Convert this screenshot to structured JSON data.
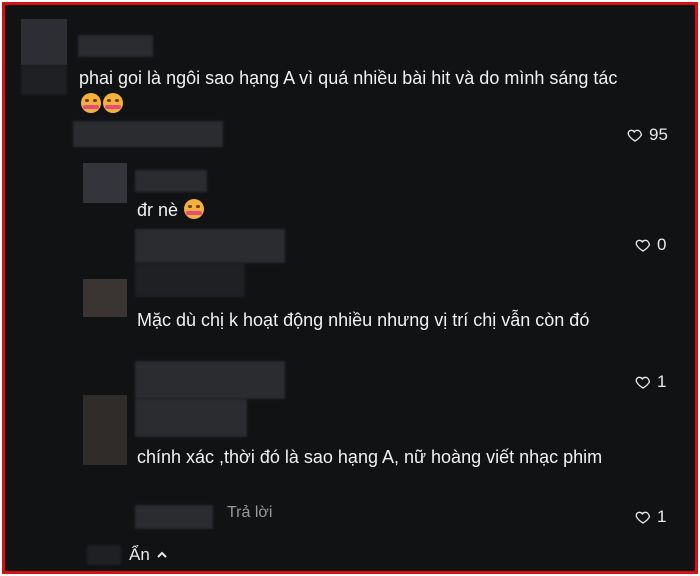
{
  "comments": [
    {
      "text": "phai goi là ngôi sao hạng A vì quá nhiều bài hit và do mình sáng tác",
      "emojis": [
        "smiling-face-with-hearts",
        "smiling-face-with-hearts"
      ],
      "likes": "95"
    }
  ],
  "replies": [
    {
      "text": "đr nè",
      "emojis": [
        "smiling-face-with-hearts"
      ],
      "likes": "0"
    },
    {
      "text": "Mặc dù chị k hoạt động nhiều nhưng vị trí chị vẫn còn đó",
      "likes": "1"
    },
    {
      "text": "chính xác ,thời đó là sao hạng A, nữ hoàng viết nhạc phim",
      "reply_label": "Trả lời",
      "likes": "1"
    }
  ],
  "footer": {
    "hide_label": "Ẩn"
  },
  "colors": {
    "background": "#111214",
    "border": "#d60f14",
    "text": "#f1f1f1",
    "muted": "#9a9a9a"
  }
}
